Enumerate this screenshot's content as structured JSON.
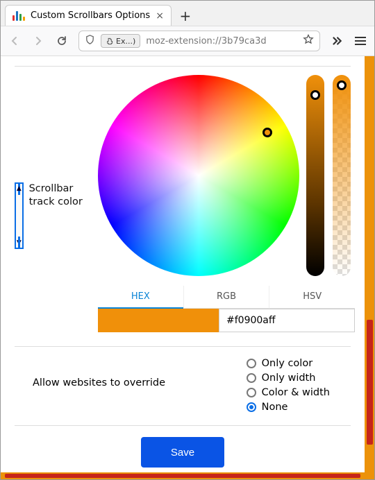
{
  "window": {
    "tab_title": "Custom Scrollbars Options",
    "url_pill": "Ex...)",
    "url": "moz-extension://3b79ca3d"
  },
  "picker": {
    "label": "Scrollbar track color",
    "modes": {
      "hex": "HEX",
      "rgb": "RGB",
      "hsv": "HSV"
    },
    "active_mode": "hex",
    "hex_value": "#f0900aff",
    "color": "#f0900a"
  },
  "override": {
    "label": "Allow websites to override",
    "options": {
      "only_color": "Only color",
      "only_width": "Only width",
      "color_width": "Color & width",
      "none": "None"
    },
    "selected": "none"
  },
  "footer": {
    "save": "Save"
  }
}
